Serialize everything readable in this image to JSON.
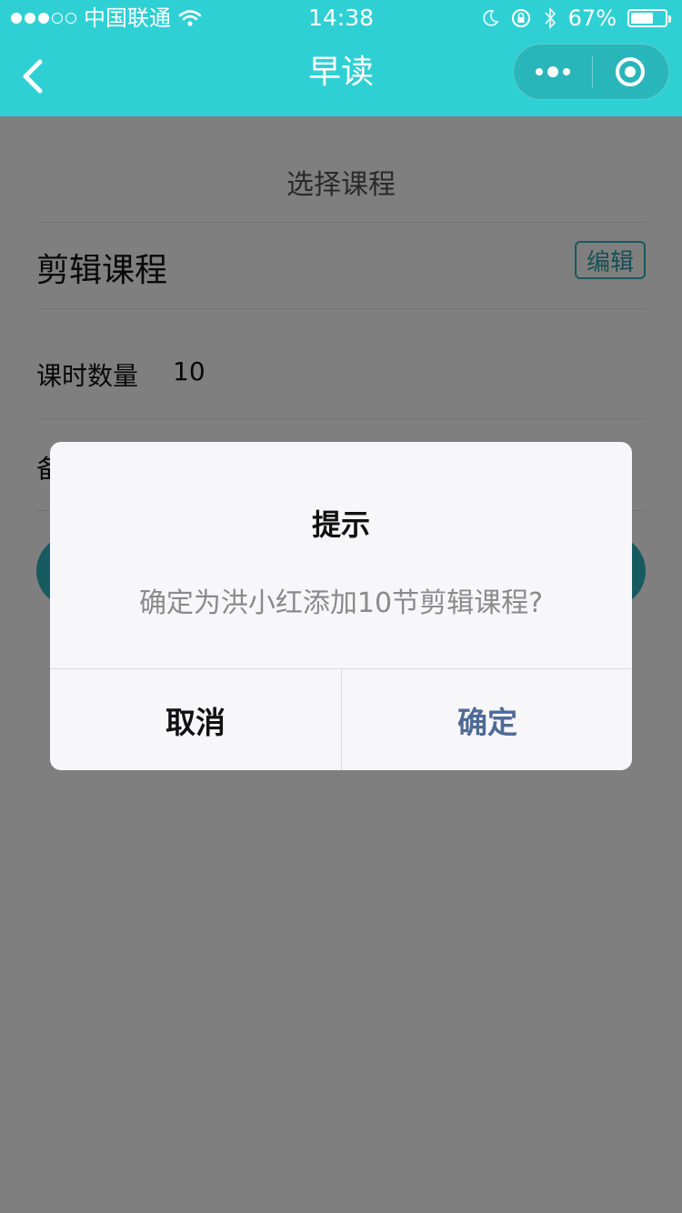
{
  "status_bar": {
    "carrier": "中国联通",
    "time": "14:38",
    "battery_percent": "67%",
    "battery_level": 0.67,
    "signal_filled": 3,
    "signal_total": 5
  },
  "nav": {
    "title": "早读",
    "back_icon": "chevron-left-icon",
    "more_icon": "more-dots-icon",
    "close_icon": "target-circle-icon"
  },
  "page": {
    "section_title": "选择课程",
    "course_name": "剪辑课程",
    "edit_label": "编辑",
    "hours_label": "课时数量",
    "hours_value": "10",
    "remark_label_partial": "备"
  },
  "dialog": {
    "title": "提示",
    "message": "确定为洪小红添加10节剪辑课程?",
    "cancel_label": "取消",
    "confirm_label": "确定"
  },
  "colors": {
    "accent": "#2fd0d4",
    "button": "#2fb4bf",
    "confirm_text": "#4e6a96",
    "mask": "rgba(0,0,0,0.5)"
  }
}
